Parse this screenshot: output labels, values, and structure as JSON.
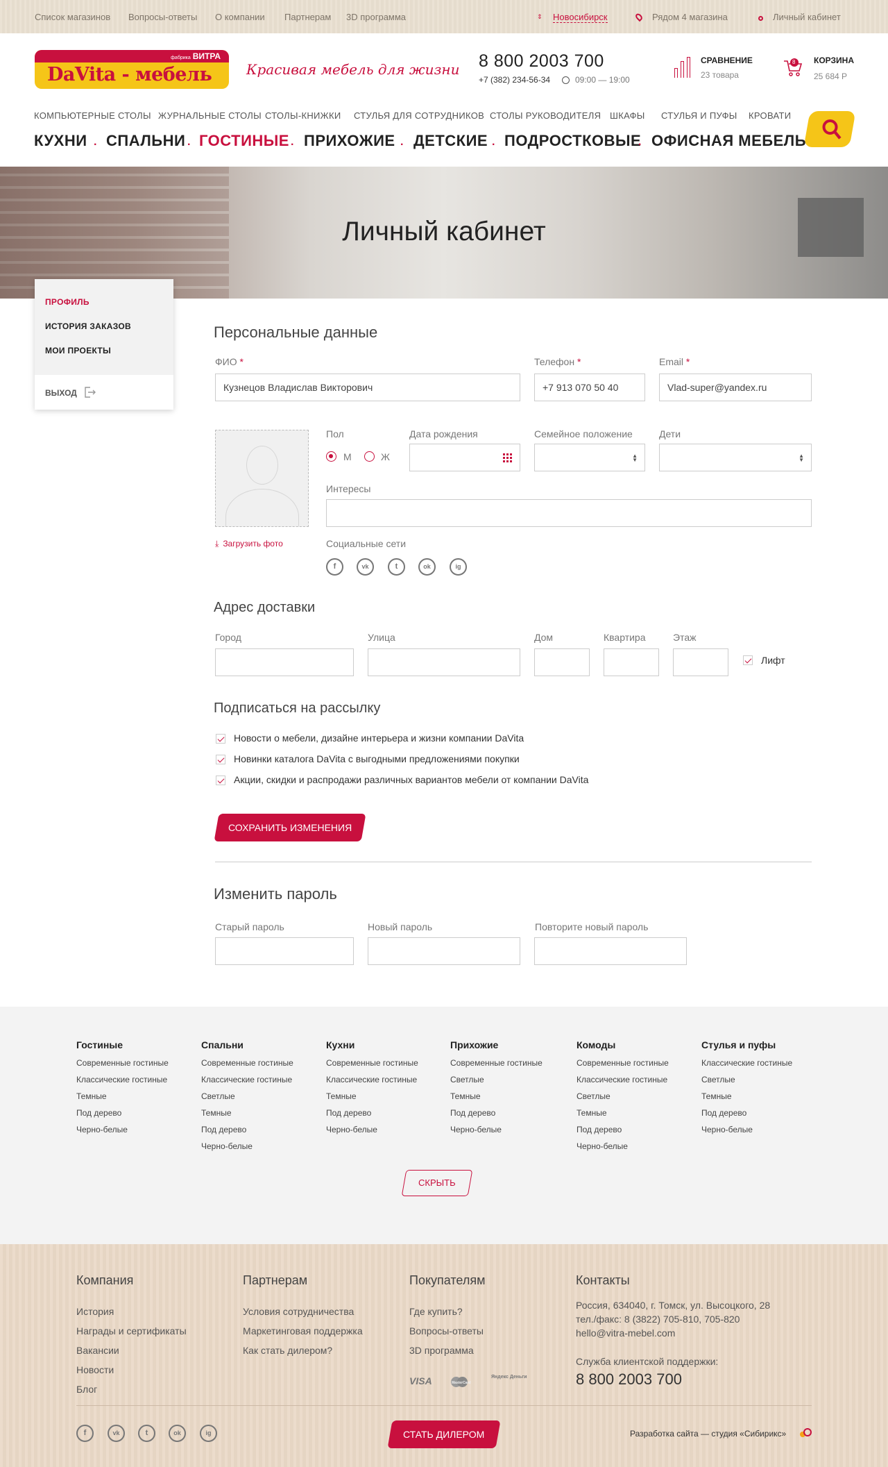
{
  "topbar": {
    "links": [
      "Список магазинов",
      "Вопросы-ответы",
      "О компании",
      "Партнерам",
      "3D программа"
    ],
    "city": "Новосибирск",
    "nearby": "Рядом 4 магазина",
    "account": "Личный кабинет"
  },
  "header": {
    "logo_top": "ВИТРА",
    "logo_small": "фабрика",
    "logo_name": "DaVita - мебель",
    "slogan": "Красивая мебель для жизни",
    "phone": "8 800 2003 700",
    "phone2": "+7 (382) 234-56-34",
    "hours": "09:00 — 19:00",
    "compare_label": "СРАВНЕНИЕ",
    "compare_count": "23 товара",
    "cart_label": "КОРЗИНА",
    "cart_sum": "25 684 Р",
    "cart_badge": "8"
  },
  "nav": {
    "row1": [
      "КОМПЬЮТЕРНЫЕ СТОЛЫ",
      "ЖУРНАЛЬНЫЕ СТОЛЫ",
      "СТОЛЫ-КНИЖКИ",
      "СТУЛЬЯ ДЛЯ СОТРУДНИКОВ",
      "СТОЛЫ РУКОВОДИТЕЛЯ",
      "ШКАФЫ",
      "СТУЛЬЯ И ПУФЫ",
      "КРОВАТИ"
    ],
    "row2": [
      "КУХНИ",
      "СПАЛЬНИ",
      "ГОСТИНЫЕ",
      "ПРИХОЖИЕ",
      "ДЕТСКИЕ",
      "ПОДРОСТКОВЫЕ",
      "ОФИСНАЯ МЕБЕЛЬ"
    ],
    "active": "ГОСТИНЫЕ"
  },
  "hero": {
    "title": "Личный кабинет"
  },
  "sidebar": {
    "items": [
      "ПРОФИЛЬ",
      "ИСТОРИЯ ЗАКАЗОВ",
      "МОИ ПРОЕКТЫ"
    ],
    "logout": "ВЫХОД"
  },
  "personal": {
    "title": "Персональные данные",
    "fio_label": "ФИО",
    "fio_value": "Кузнецов Владислав Викторович",
    "phone_label": "Телефон",
    "phone_value": "+7 913 070 50 40",
    "email_label": "Email",
    "email_value": "Vlad-super@yandex.ru",
    "required_mark": "*",
    "gender_label": "Пол",
    "gender_m": "М",
    "gender_f": "Ж",
    "birth_label": "Дата рождения",
    "family_label": "Семейное положение",
    "children_label": "Дети",
    "interests_label": "Интересы",
    "upload_photo": "Загрузить фото",
    "social_label": "Социальные сети",
    "socials": [
      "f",
      "vk",
      "t",
      "ok",
      "ig"
    ]
  },
  "address": {
    "title": "Адрес доставки",
    "city_label": "Город",
    "street_label": "Улица",
    "house_label": "Дом",
    "apt_label": "Квартира",
    "floor_label": "Этаж",
    "lift_label": "Лифт"
  },
  "subscribe": {
    "title": "Подписаться на рассылку",
    "options": [
      "Новости о мебели, дизайне интерьера и жизни компании DaVita",
      "Новинки каталога DaVita с выгодными предложениями покупки",
      "Акции, скидки и распродажи различных вариантов мебели от компании DaVita"
    ],
    "save_button": "СОХРАНИТЬ ИЗМЕНЕНИЯ"
  },
  "password": {
    "title": "Изменить пароль",
    "old_label": "Старый пароль",
    "new_label": "Новый пароль",
    "repeat_label": "Повторите новый пароль"
  },
  "footer_catalog": {
    "columns": [
      {
        "title": "Гостиные",
        "items": [
          "Современные гостиные",
          "Классические гостиные",
          "Темные",
          "Под дерево",
          "Черно-белые"
        ]
      },
      {
        "title": "Спальни",
        "items": [
          "Современные гостиные",
          "Классические гостиные",
          "Светлые",
          "Темные",
          "Под дерево",
          "Черно-белые"
        ]
      },
      {
        "title": "Кухни",
        "items": [
          "Современные гостиные",
          "Классические гостиные",
          "Темные",
          "Под дерево",
          "Черно-белые"
        ]
      },
      {
        "title": "Прихожие",
        "items": [
          "Современные гостиные",
          "Светлые",
          "Темные",
          "Под дерево",
          "Черно-белые"
        ]
      },
      {
        "title": "Комоды",
        "items": [
          "Современные гостиные",
          "Классические гостиные",
          "Светлые",
          "Темные",
          "Под дерево",
          "Черно-белые"
        ]
      },
      {
        "title": "Стулья и пуфы",
        "items": [
          "Классические гостиные",
          "Светлые",
          "Темные",
          "Под дерево",
          "Черно-белые"
        ]
      }
    ],
    "hide_button": "СКРЫТЬ"
  },
  "footer": {
    "company_title": "Компания",
    "company_items": [
      "История",
      "Награды и сертификаты",
      "Вакансии",
      "Новости",
      "Блог"
    ],
    "partners_title": "Партнерам",
    "partners_items": [
      "Условия сотрудничества",
      "Маркетинговая поддержка",
      "Как стать дилером?"
    ],
    "buyers_title": "Покупателям",
    "buyers_items": [
      "Где купить?",
      "Вопросы-ответы",
      "3D программа"
    ],
    "payments": [
      "VISA",
      "MasterCard",
      "Яндекс Деньги"
    ],
    "contacts_title": "Контакты",
    "address": "Россия, 634040, г. Томск, ул. Высоцкого, 28",
    "tel_fax": "тел./факс: 8 (3822) 705-810, 705-820",
    "email": "hello@vitra-mebel.com",
    "support_label": "Служба клиентской поддержки:",
    "support_phone": "8 800 2003 700",
    "dealer_button": "СТАТЬ ДИЛЕРОМ",
    "developer": "Разработка сайта — студия «Сибирикс»",
    "socials": [
      "f",
      "vk",
      "t",
      "ok",
      "ig"
    ]
  },
  "colors": {
    "accent": "#c8103e",
    "yellow": "#f5c518",
    "wood": "#ead9c7",
    "light_bg": "#f3f3f3"
  }
}
